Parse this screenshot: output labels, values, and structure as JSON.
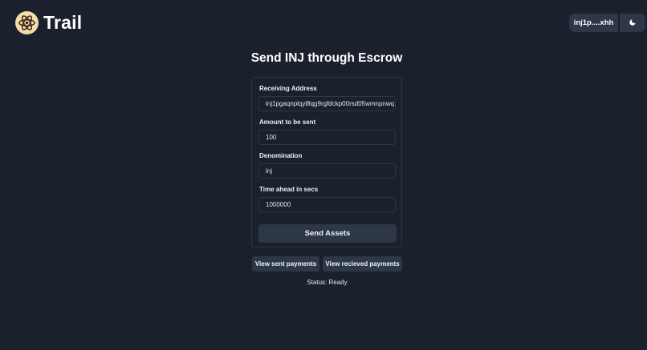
{
  "header": {
    "brand": "Trail",
    "wallet_label": "inj1p....xhh",
    "theme_toggle_icon": "moon-icon"
  },
  "colors": {
    "background": "#1a202c",
    "surface": "#2d3748",
    "logo_bg": "#f3dca7",
    "logo_fg": "#3b2a1a"
  },
  "main": {
    "title": "Send INJ through Escrow",
    "form": {
      "receiving_address_label": "Receiving Address",
      "receiving_address_value": "inj1pgaqnplqyl8qg9rgfdckp00rsd05wmnpnwq",
      "amount_label": "Amount to be sent",
      "amount_value": "100",
      "denomination_label": "Denomination",
      "denomination_value": "inj",
      "time_label": "Time ahead in secs",
      "time_value": "1000000",
      "submit_label": "Send Assets"
    },
    "view_sent_label": "View sent payments",
    "view_received_label": "View recieved payments",
    "status": "Status: Ready"
  }
}
